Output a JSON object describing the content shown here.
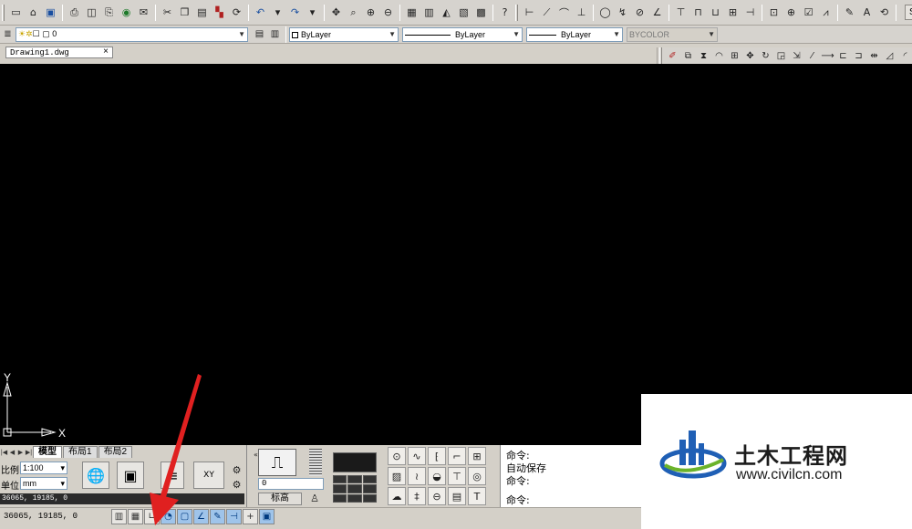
{
  "app": {
    "title_fragment": "STA"
  },
  "document_tab": {
    "label": "Drawing1.dwg",
    "close": "×"
  },
  "layer_toolbar": {
    "current_layer": "0"
  },
  "properties_toolbar": {
    "color": "ByLayer",
    "linetype": "ByLayer",
    "lineweight": "ByLayer",
    "plotstyle": "BYCOLOR"
  },
  "ucs": {
    "x_label": "X",
    "y_label": "Y"
  },
  "layout_tabs": [
    {
      "label": "模型",
      "active": true
    },
    {
      "label": "布局1",
      "active": false
    },
    {
      "label": "布局2",
      "active": false
    }
  ],
  "annotation": {
    "scale_label": "比例",
    "scale_value": "1:100",
    "unit_label": "单位",
    "unit_value": "mm"
  },
  "coordinate_bar": "36065, 19185, 0",
  "tile_panel": {
    "value": "0",
    "label": "标高"
  },
  "command_line": {
    "line1": "命令:",
    "line2": "自动保存",
    "line3": "命令:",
    "line4": "命令:"
  },
  "status_bar": {
    "coords": "36065, 19185, 0"
  },
  "watermark": {
    "title": "土木工程网",
    "url": "www.civilcn.com"
  },
  "colors": {
    "canvas_bg": "#000000",
    "toolbar_bg": "#d6d3ce",
    "annotation_arrow": "#e02020",
    "logo_blue": "#1f5fb5",
    "logo_green": "#6bb32a"
  }
}
